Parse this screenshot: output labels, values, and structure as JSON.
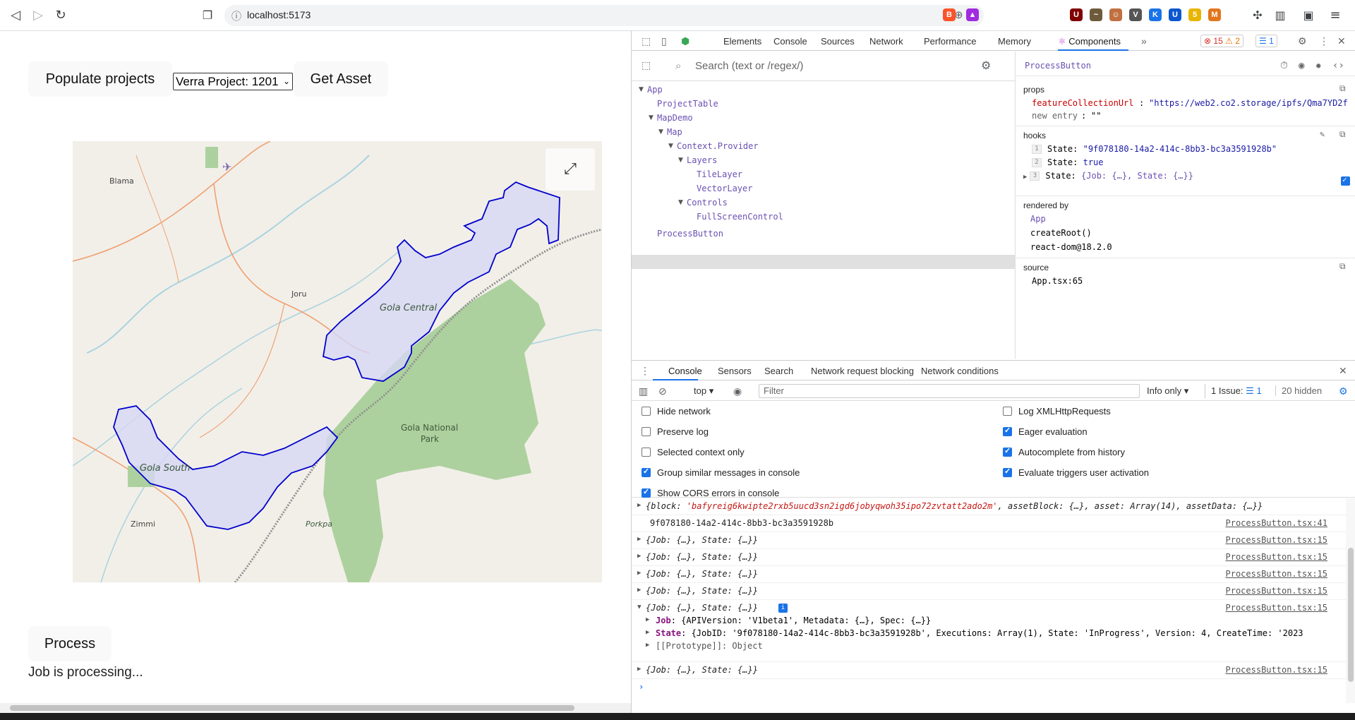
{
  "browser": {
    "url": "localhost:5173",
    "extensions": [
      {
        "name": "ublock-icon",
        "color": "#800000",
        "glyph": "U"
      },
      {
        "name": "ext2-icon",
        "color": "#6d5a3a",
        "glyph": "~"
      },
      {
        "name": "ext3-icon",
        "color": "#c07040",
        "glyph": "☺"
      },
      {
        "name": "ext4-icon",
        "color": "#555555",
        "glyph": "V"
      },
      {
        "name": "ext5-icon",
        "color": "#1a73e8",
        "glyph": "K"
      },
      {
        "name": "ext6-icon",
        "color": "#0b57d0",
        "glyph": "U"
      },
      {
        "name": "ext7-icon",
        "color": "#e8b500",
        "glyph": "5"
      },
      {
        "name": "metamask-icon",
        "color": "#e2761b",
        "glyph": "M"
      }
    ]
  },
  "app": {
    "populate_label": "Populate projects",
    "project_select_value": "Verra Project: 1201",
    "get_asset_label": "Get Asset",
    "process_label": "Process",
    "job_status": "Job is processing...",
    "fullscreen_glyph": "⤢"
  },
  "map": {
    "labels": {
      "blama": "Blama",
      "joru": "Joru",
      "zimmi": "Zimmi",
      "porkpa": "Porkpa",
      "gola_central": "Gola Central",
      "gola_south": "Gola South",
      "gola_national_line1": "Gola National",
      "gola_national_line2": "Park"
    },
    "colors": {
      "base": "#f2efe9",
      "park": "#add19e",
      "reserve_fill": "#d6d7f5",
      "reserve_stroke": "#0000cc",
      "water": "#aad3df",
      "road": "#f0a070",
      "border": "#8e8e8e"
    }
  },
  "devtools": {
    "tabs": [
      "Elements",
      "Console",
      "Sources",
      "Network",
      "Performance",
      "Memory",
      "Components"
    ],
    "active_tab": "Components",
    "errors": "15",
    "warnings": "2",
    "issues": "1",
    "search_placeholder": "Search (text or /regex/)",
    "tree": [
      {
        "label": "App",
        "depth": 0,
        "arrow": true
      },
      {
        "label": "ProjectTable",
        "depth": 1,
        "arrow": false
      },
      {
        "label": "MapDemo",
        "depth": 1,
        "arrow": true
      },
      {
        "label": "Map",
        "depth": 2,
        "arrow": true
      },
      {
        "label": "Context.Provider",
        "depth": 3,
        "arrow": true
      },
      {
        "label": "Layers",
        "depth": 4,
        "arrow": true
      },
      {
        "label": "TileLayer",
        "depth": 5,
        "arrow": false
      },
      {
        "label": "VectorLayer",
        "depth": 5,
        "arrow": false
      },
      {
        "label": "Controls",
        "depth": 4,
        "arrow": true
      },
      {
        "label": "FullScreenControl",
        "depth": 5,
        "arrow": false
      },
      {
        "label": "ProcessButton",
        "depth": 1,
        "arrow": false
      }
    ],
    "inspect": {
      "component": "ProcessButton",
      "props_title": "props",
      "prop_key": "featureCollectionUrl",
      "prop_value": "\"https://web2.co2.storage/ipfs/Qma7YD2f",
      "new_entry_key": "new entry",
      "new_entry_value": "\"\"",
      "hooks_title": "hooks",
      "hooks": [
        {
          "idx": "1",
          "label": "State:",
          "value": "\"9f078180-14a2-414c-8bb3-bc3a3591928b\""
        },
        {
          "idx": "2",
          "label": "State:",
          "value": "true"
        },
        {
          "idx": "3",
          "label": "State:",
          "value": "{Job: {…}, State: {…}}"
        }
      ],
      "rendered_by_title": "rendered by",
      "rendered_by": [
        "App",
        "createRoot()",
        "react-dom@18.2.0"
      ],
      "source_title": "source",
      "source": "App.tsx:65"
    },
    "drawer_tabs": [
      "Console",
      "Sensors",
      "Search",
      "Network request blocking",
      "Network conditions"
    ],
    "console_context": "top",
    "filter_placeholder": "Filter",
    "level": "Info only",
    "issue_count": "1 Issue:",
    "issue_badge": "1",
    "hidden": "20 hidden",
    "settings_left": [
      {
        "label": "Hide network",
        "checked": false
      },
      {
        "label": "Preserve log",
        "checked": false
      },
      {
        "label": "Selected context only",
        "checked": false
      },
      {
        "label": "Group similar messages in console",
        "checked": true
      },
      {
        "label": "Show CORS errors in console",
        "checked": true
      }
    ],
    "settings_right": [
      {
        "label": "Log XMLHttpRequests",
        "checked": false
      },
      {
        "label": "Eager evaluation",
        "checked": true
      },
      {
        "label": "Autocomplete from history",
        "checked": true
      },
      {
        "label": "Evaluate triggers user activation",
        "checked": true
      }
    ],
    "log": {
      "block_key": "block",
      "block_value": "'bafyreig6kwipte2rxb5uucd3sn2igd6jobyqwoh35ipo72zvtatt2ado2m'",
      "block_rest": ", assetBlock: {…}, asset: Array(14), assetData: {…}}",
      "uuid": "9f078180-14a2-414c-8bb3-bc3a3591928b",
      "uuid_src": "ProcessButton.tsx:41",
      "job_obj": "{Job: {…}, State: {…}}",
      "job_src": "ProcessButton.tsx:15",
      "expanded_job_key": "Job",
      "expanded_job_value": "{APIVersion: 'V1beta1', Metadata: {…}, Spec: {…}}",
      "expanded_state_key": "State",
      "expanded_state_value": "{JobID: '9f078180-14a2-414c-8bb3-bc3a3591928b', Executions: Array(1), State: 'InProgress', Version: 4, CreateTime: '2023",
      "prototype": "[[Prototype]]: Object"
    }
  }
}
